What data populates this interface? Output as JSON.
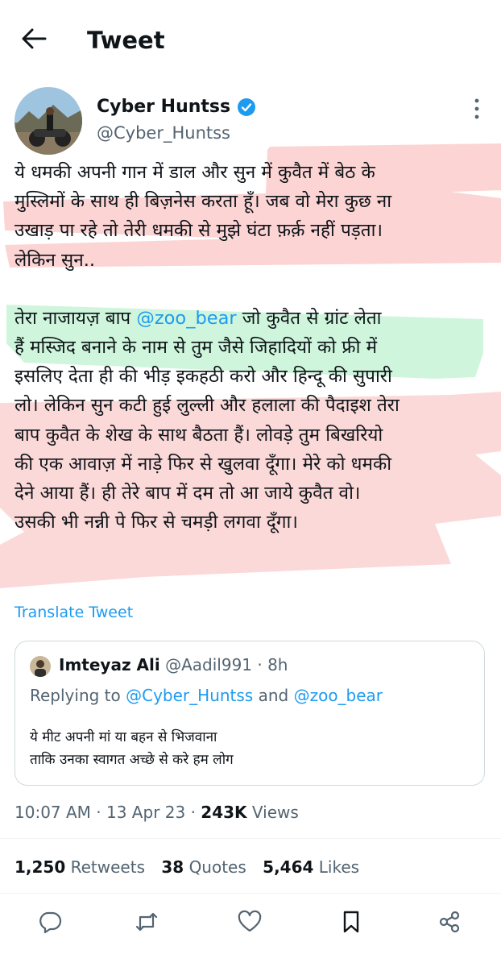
{
  "header": {
    "title": "Tweet"
  },
  "author": {
    "name": "Cyber Huntss",
    "handle": "@Cyber_Huntss"
  },
  "tweet": {
    "para1": [
      "ये धमकी अपनी गान में डाल और सुन में कुवैत में बेठ के",
      "मुस्लिमों के साथ ही बिज़नेस करता हूँ। जब वो मेरा कुछ ना",
      "उखाड़ पा रहे तो तेरी धमकी से मुझे घंटा फ़र्क़ नहीं पड़ता।",
      "लेकिन सुन.."
    ],
    "line5_prefix": "तेरा नाजायज़ बाप ",
    "mention": "@zoo_bear",
    "line5_suffix": " जो कुवैत से ग्रांट लेता",
    "para2_rest": [
      "हैं मस्जिद बनाने के  नाम से तुम जैसे जिहादियों को फ्री में",
      "इसलिए देता ही की भीड़ इकहठी करो और हिन्दू की सुपारी",
      "लो। लेकिन सुन कटी हुई लुल्ली और हलाला की पैदाइश तेरा",
      "बाप कुवैत के शेख के साथ बैठता हैं। लोवड़े तुम बिखरियो",
      "की एक आवाज़ में नाड़े फिर से खुलवा दूँगा। मेरे को धमकी",
      "देने आया हैं। ही तेरे बाप में दम तो आ जाये कुवैत वो।",
      "उसकी भी नन्नी पे फिर से चमड़ी लगवा दूँगा।"
    ]
  },
  "translate_label": "Translate Tweet",
  "quote": {
    "name": "Imteyaz Ali",
    "meta": " @Aadil991 · 8h",
    "reply_prefix": "Replying to ",
    "reply_mention1": "@Cyber_Huntss",
    "reply_and": " and ",
    "reply_mention2": "@zoo_bear",
    "body": [
      "ये मीट अपनी मां या बहन से भिजवाना",
      "ताकि उनका स्वागत अच्छे से करे हम लोग"
    ]
  },
  "meta": {
    "time": "10:07 AM · 13 Apr 23 · ",
    "views_count": "243K",
    "views_label": " Views"
  },
  "stats": {
    "retweets_count": "1,250",
    "retweets_label": "Retweets",
    "quotes_count": "38",
    "quotes_label": "Quotes",
    "likes_count": "5,464",
    "likes_label": "Likes"
  },
  "colors": {
    "accent": "#1d9bf0",
    "text": "#0f1419",
    "muted": "#536471",
    "highlight_red": "#f8a0a0",
    "highlight_green": "#a8eec0"
  },
  "icons": [
    "back-arrow-icon",
    "verified-icon",
    "more-icon",
    "reply-icon",
    "retweet-icon",
    "like-icon",
    "bookmark-icon",
    "share-icon"
  ]
}
